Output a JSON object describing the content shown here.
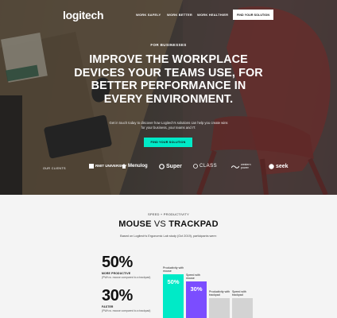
{
  "nav": {
    "logo": "logitech",
    "links": [
      "WORK SAFELY",
      "WORK BETTER",
      "WORK HEALTHIER"
    ],
    "cta": "FIND YOUR SOLUTION"
  },
  "hero": {
    "eyebrow": "FOR BUSINESSES",
    "headline": "IMPROVE THE WORKPLACE DEVICES YOUR TEAMS USE, FOR BETTER PERFORMANCE IN EVERY ENVIRONMENT.",
    "subtext": "Get in touch today to discover how Logitech's solutions can help you create wins for your business, your teams and IT.",
    "cta": "FIND YOUR SOLUTION",
    "clients": [
      "OUR CLIENTS",
      "RMIT UNIVERSITY",
      "Menulog",
      "Super",
      "CLASS",
      "western power",
      "seek"
    ]
  },
  "colors": {
    "accent": "#00eac7",
    "purple": "#7b4dff",
    "bar_gray": "#d3d3d3"
  },
  "lower": {
    "eyebrow": "SPEED + PRODUCTIVITY",
    "title_a": "MOUSE",
    "title_vs": "VS",
    "title_b": "TRACKPAD",
    "sub": "Based on Logitech's Ergonomic Lab study (Oct 2019), participants were:",
    "stats": [
      {
        "num": "50%",
        "label": "MORE PRODUCTIVE",
        "desc": "(PWh w. mouse compared to a trackpad)"
      },
      {
        "num": "30%",
        "label": "FASTER",
        "desc": "(PWh w. mouse compared to a trackpad)"
      }
    ],
    "bars": [
      {
        "caption": "Productivity with mouse",
        "value": "50%",
        "color": "accent",
        "level": 1.0
      },
      {
        "caption": "Speed with mouse",
        "value": "30%",
        "color": "purple",
        "level": 0.83
      },
      {
        "caption": "Productivity with trackpad",
        "value": "",
        "color": "bar_gray",
        "level": 0.45
      },
      {
        "caption": "Speed with trackpad",
        "value": "",
        "color": "bar_gray",
        "level": 0.45
      }
    ]
  }
}
